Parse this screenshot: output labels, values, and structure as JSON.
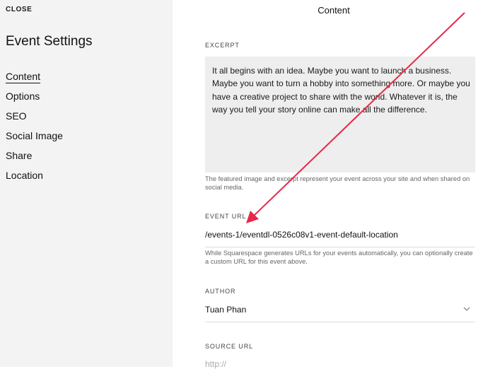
{
  "sidebar": {
    "close_label": "CLOSE",
    "title": "Event Settings",
    "items": [
      {
        "label": "Content",
        "active": true
      },
      {
        "label": "Options",
        "active": false
      },
      {
        "label": "SEO",
        "active": false
      },
      {
        "label": "Social Image",
        "active": false
      },
      {
        "label": "Share",
        "active": false
      },
      {
        "label": "Location",
        "active": false
      }
    ]
  },
  "main": {
    "header": "Content",
    "excerpt": {
      "label": "EXCERPT",
      "text": "It all begins with an idea. Maybe you want to launch a business. Maybe you want to turn a hobby into something more. Or maybe you have a creative project to share with the world. Whatever it is, the way you tell your story online can make all the difference.",
      "help": "The featured image and excerpt represent your event across your site and when shared on social media."
    },
    "event_url": {
      "label": "EVENT URL",
      "value": "/events-1/eventdl-0526c08v1-event-default-location",
      "help": "While Squarespace generates URLs for your events automatically, you can optionally create a custom URL for this event above."
    },
    "author": {
      "label": "AUTHOR",
      "value": "Tuan Phan"
    },
    "source_url": {
      "label": "SOURCE URL",
      "placeholder": "http://"
    }
  },
  "annotation": {
    "arrow_color": "#e8284a"
  },
  "icons": {
    "author_dropdown": "chevron-down-icon"
  }
}
